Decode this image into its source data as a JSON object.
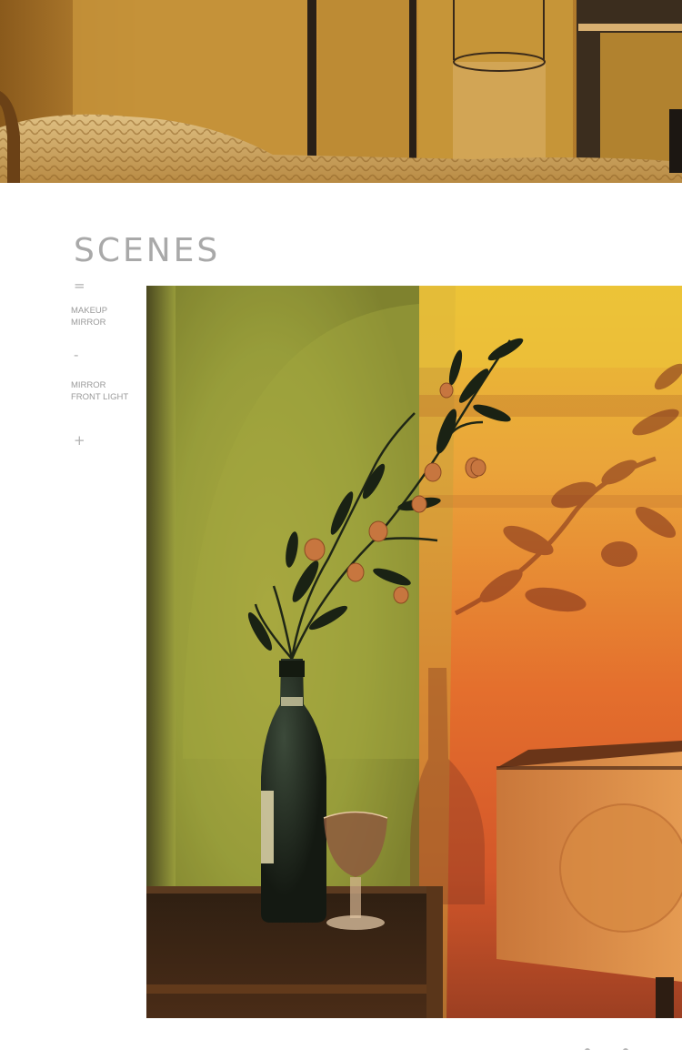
{
  "section": {
    "title": "SCENES"
  },
  "scene_menu": {
    "items": [
      {
        "symbol": "=",
        "label_line1": "MAKEUP",
        "label_line2": "MIRROR"
      },
      {
        "symbol": "-",
        "label_line1": "MIRROR",
        "label_line2": "FRONT LIGHT"
      },
      {
        "symbol": "+",
        "label_line1": "",
        "label_line2": ""
      }
    ]
  },
  "colors": {
    "title": "#a9a9a9",
    "menu_text": "#9a9a9a",
    "background": "#ffffff",
    "sunset_orange": "#e8732a",
    "sunset_yellow": "#e8c233",
    "wall_green": "#8f9b3a"
  },
  "images": {
    "top_photo": "bedroom-interior-photo",
    "main_photo": "sunset-lamp-still-life-photo"
  }
}
